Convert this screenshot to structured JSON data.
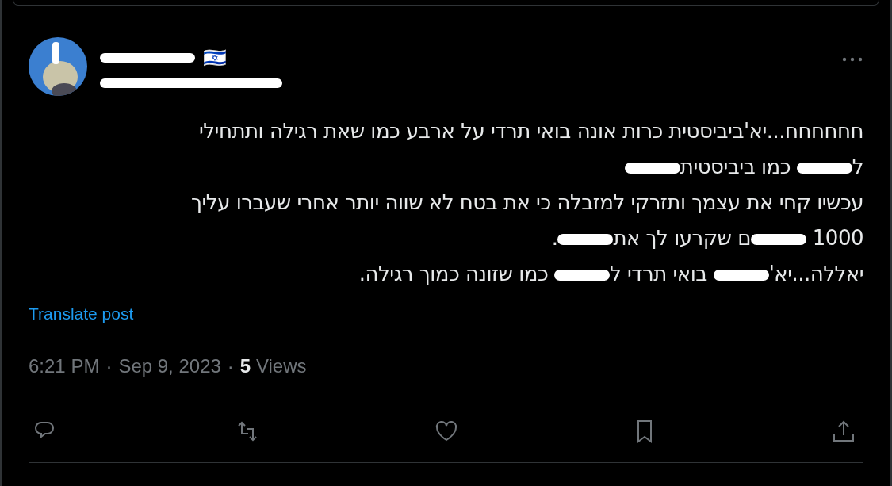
{
  "post": {
    "author": {
      "name_redacted": true,
      "handle_redacted": true,
      "flag": "🇮🇱"
    },
    "body": [
      [
        {
          "kind": "text",
          "text": "חחחחחח...יא'ביביסטית כרות אונה בואי תרדי על ארבע כמו שאת רגילה ותתחילי"
        }
      ],
      [
        {
          "kind": "text",
          "text": "ל"
        },
        {
          "kind": "redaction"
        },
        {
          "kind": "text",
          "text": " כמו ביביסטית"
        },
        {
          "kind": "redaction"
        }
      ],
      [
        {
          "kind": "text",
          "text": "עכשיו קחי את עצמך ותזרקי למזבלה כי את בטח לא שווה יותר אחרי שעברו עליך"
        }
      ],
      [
        {
          "kind": "text",
          "text": "1000 "
        },
        {
          "kind": "redaction"
        },
        {
          "kind": "text",
          "text": "ם שקרעו לך את"
        },
        {
          "kind": "redaction"
        },
        {
          "kind": "text",
          "text": "."
        }
      ],
      [
        {
          "kind": "text",
          "text": "יאללה...יא'"
        },
        {
          "kind": "redaction"
        },
        {
          "kind": "text",
          "text": " בואי תרדי ל"
        },
        {
          "kind": "redaction"
        },
        {
          "kind": "text",
          "text": " כמו שזונה כמוך רגילה."
        }
      ]
    ],
    "translate_link": "Translate post",
    "meta": {
      "time": "6:21 PM",
      "separator": "·",
      "date": "Sep 9, 2023",
      "views_count": "5",
      "views_label": "Views"
    },
    "actions": [
      {
        "kind": "reply"
      },
      {
        "kind": "repost"
      },
      {
        "kind": "like"
      },
      {
        "kind": "bookmark"
      },
      {
        "kind": "share"
      }
    ]
  }
}
